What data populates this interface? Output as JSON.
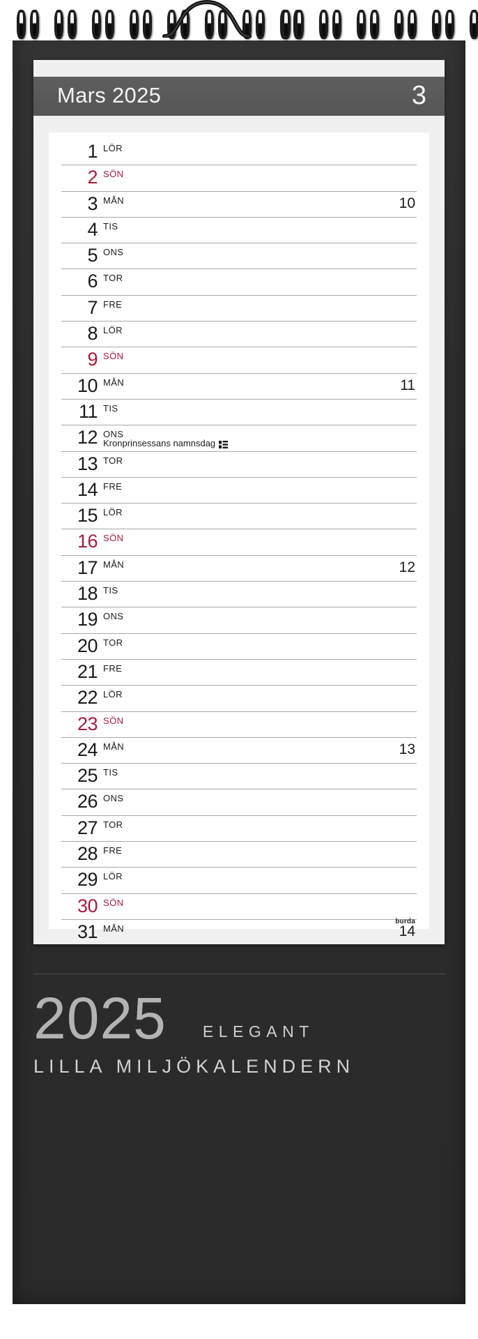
{
  "calendar": {
    "brand_logo": "burda",
    "header": {
      "month_title": "Mars 2025",
      "month_number": "3"
    },
    "footer": {
      "year": "2025",
      "series": "ELEGANT",
      "product_name": "LILLA MILJÖKALENDERN"
    },
    "colors": {
      "board": "#2e2e2e",
      "sheet": "#f0f0f0",
      "header_band": "#5a5a5a",
      "sunday_red": "#a81c3c",
      "rule": "#a9a9a9",
      "brand_text": "#cfcfcf"
    },
    "days": [
      {
        "num": "1",
        "abbr": "LÖR",
        "sunday": false,
        "week": "",
        "note": "",
        "flag": false
      },
      {
        "num": "2",
        "abbr": "SÖN",
        "sunday": true,
        "week": "",
        "note": "",
        "flag": false
      },
      {
        "num": "3",
        "abbr": "MÅN",
        "sunday": false,
        "week": "10",
        "note": "",
        "flag": false
      },
      {
        "num": "4",
        "abbr": "TIS",
        "sunday": false,
        "week": "",
        "note": "",
        "flag": false
      },
      {
        "num": "5",
        "abbr": "ONS",
        "sunday": false,
        "week": "",
        "note": "",
        "flag": false
      },
      {
        "num": "6",
        "abbr": "TOR",
        "sunday": false,
        "week": "",
        "note": "",
        "flag": false
      },
      {
        "num": "7",
        "abbr": "FRE",
        "sunday": false,
        "week": "",
        "note": "",
        "flag": false
      },
      {
        "num": "8",
        "abbr": "LÖR",
        "sunday": false,
        "week": "",
        "note": "",
        "flag": false
      },
      {
        "num": "9",
        "abbr": "SÖN",
        "sunday": true,
        "week": "",
        "note": "",
        "flag": false
      },
      {
        "num": "10",
        "abbr": "MÅN",
        "sunday": false,
        "week": "11",
        "note": "",
        "flag": false
      },
      {
        "num": "11",
        "abbr": "TIS",
        "sunday": false,
        "week": "",
        "note": "",
        "flag": false
      },
      {
        "num": "12",
        "abbr": "ONS",
        "sunday": false,
        "week": "",
        "note": "Kronprinsessans namnsdag",
        "flag": true
      },
      {
        "num": "13",
        "abbr": "TOR",
        "sunday": false,
        "week": "",
        "note": "",
        "flag": false
      },
      {
        "num": "14",
        "abbr": "FRE",
        "sunday": false,
        "week": "",
        "note": "",
        "flag": false
      },
      {
        "num": "15",
        "abbr": "LÖR",
        "sunday": false,
        "week": "",
        "note": "",
        "flag": false
      },
      {
        "num": "16",
        "abbr": "SÖN",
        "sunday": true,
        "week": "",
        "note": "",
        "flag": false
      },
      {
        "num": "17",
        "abbr": "MÅN",
        "sunday": false,
        "week": "12",
        "note": "",
        "flag": false
      },
      {
        "num": "18",
        "abbr": "TIS",
        "sunday": false,
        "week": "",
        "note": "",
        "flag": false
      },
      {
        "num": "19",
        "abbr": "ONS",
        "sunday": false,
        "week": "",
        "note": "",
        "flag": false
      },
      {
        "num": "20",
        "abbr": "TOR",
        "sunday": false,
        "week": "",
        "note": "",
        "flag": false
      },
      {
        "num": "21",
        "abbr": "FRE",
        "sunday": false,
        "week": "",
        "note": "",
        "flag": false
      },
      {
        "num": "22",
        "abbr": "LÖR",
        "sunday": false,
        "week": "",
        "note": "",
        "flag": false
      },
      {
        "num": "23",
        "abbr": "SÖN",
        "sunday": true,
        "week": "",
        "note": "",
        "flag": false
      },
      {
        "num": "24",
        "abbr": "MÅN",
        "sunday": false,
        "week": "13",
        "note": "",
        "flag": false
      },
      {
        "num": "25",
        "abbr": "TIS",
        "sunday": false,
        "week": "",
        "note": "",
        "flag": false
      },
      {
        "num": "26",
        "abbr": "ONS",
        "sunday": false,
        "week": "",
        "note": "",
        "flag": false
      },
      {
        "num": "27",
        "abbr": "TOR",
        "sunday": false,
        "week": "",
        "note": "",
        "flag": false
      },
      {
        "num": "28",
        "abbr": "FRE",
        "sunday": false,
        "week": "",
        "note": "",
        "flag": false
      },
      {
        "num": "29",
        "abbr": "LÖR",
        "sunday": false,
        "week": "",
        "note": "",
        "flag": false
      },
      {
        "num": "30",
        "abbr": "SÖN",
        "sunday": true,
        "week": "",
        "note": "",
        "flag": false
      },
      {
        "num": "31",
        "abbr": "MÅN",
        "sunday": false,
        "week": "14",
        "note": "",
        "flag": false
      }
    ]
  }
}
